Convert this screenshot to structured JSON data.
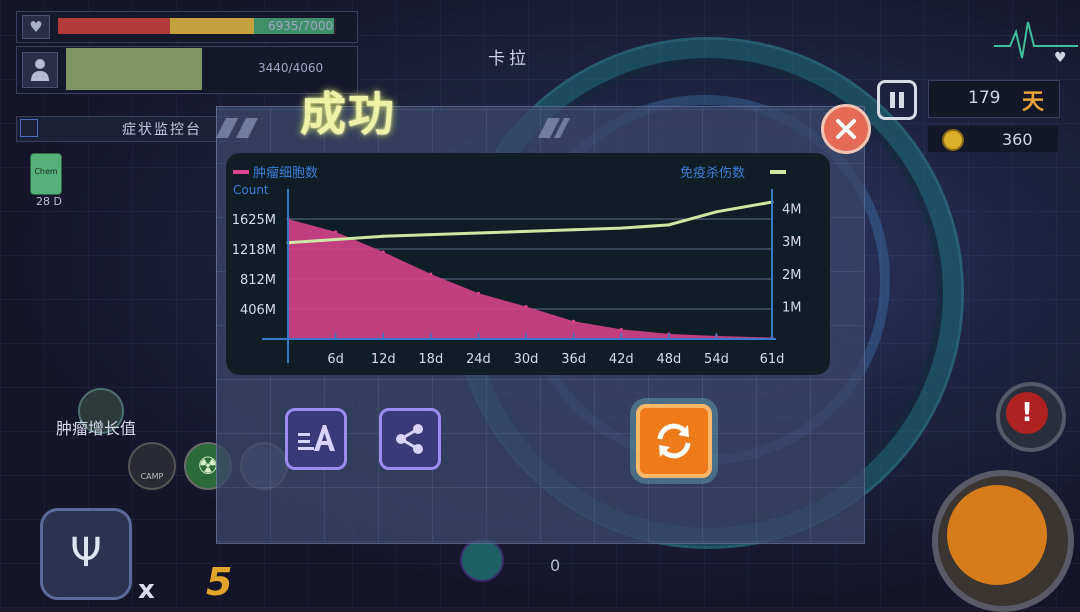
{
  "hud": {
    "health_text": "6935/7000",
    "immunity_text": "3440/4060",
    "character_name": "卡拉",
    "symptom_monitor": "症状监控台",
    "status_chip_label": "Chem",
    "status_chip_days": "28 D",
    "tumor_growth_label": "肿瘤增长值",
    "mini_icons": [
      "CAMP",
      "radiation",
      "cell"
    ],
    "day_count": "179",
    "day_unit": "天",
    "coins": "360",
    "multiplier_x": "x",
    "multiplier_value": "5",
    "bottom_counter": "0"
  },
  "dialog": {
    "title": "成功",
    "close_icon": "close-icon",
    "buttons": [
      "text-size-icon",
      "share-icon",
      "retry-icon"
    ]
  },
  "chart_data": {
    "type": "area",
    "title": "",
    "legend": [
      {
        "name": "肿瘤细胞数",
        "color": "#e0448f"
      },
      {
        "name": "免疫杀伤数",
        "color": "#cfe7a5"
      }
    ],
    "ylabel": "Count",
    "x_tick_labels": [
      "6d",
      "12d",
      "18d",
      "24d",
      "30d",
      "36d",
      "42d",
      "48d",
      "54d",
      "61d"
    ],
    "x": [
      0,
      6,
      12,
      18,
      24,
      30,
      36,
      42,
      48,
      54,
      61
    ],
    "y_left_ticks": [
      "1625M",
      "1218M",
      "812M",
      "406M"
    ],
    "y_left_values": [
      1625,
      1218,
      812,
      406
    ],
    "y_right_ticks": [
      "4M",
      "3M",
      "2M",
      "1M"
    ],
    "y_right_values": [
      4,
      3,
      2,
      1
    ],
    "ylim_left": [
      0,
      1625
    ],
    "ylim_right": [
      0,
      4.6
    ],
    "series": [
      {
        "name": "肿瘤细胞数",
        "axis": "left",
        "values": [
          1625,
          1450,
          1180,
          880,
          620,
          440,
          240,
          130,
          70,
          40,
          20
        ]
      },
      {
        "name": "免疫杀伤数",
        "axis": "right",
        "values": [
          2.95,
          3.05,
          3.15,
          3.2,
          3.25,
          3.3,
          3.35,
          3.4,
          3.5,
          3.9,
          4.2
        ]
      }
    ],
    "colors": {
      "tumor": "#e0448f",
      "immune": "#cfe7a5",
      "axis": "#3b78c8",
      "grid": "#5b6f86"
    }
  }
}
